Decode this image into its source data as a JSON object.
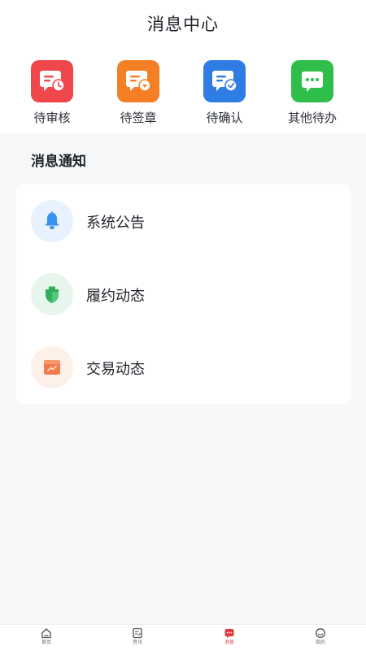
{
  "header": {
    "title": "消息中心"
  },
  "quick_actions": [
    {
      "label": "待审核",
      "icon": "pending-review-icon",
      "color": "#f0474b"
    },
    {
      "label": "待签章",
      "icon": "pending-seal-icon",
      "color": "#f47f24"
    },
    {
      "label": "待确认",
      "icon": "pending-confirm-icon",
      "color": "#2f7ce5"
    },
    {
      "label": "其他待办",
      "icon": "other-todo-icon",
      "color": "#2fbe4a"
    }
  ],
  "section": {
    "title": "消息通知"
  },
  "notifications": [
    {
      "label": "系统公告",
      "icon": "bell-icon",
      "color": "#3b8ff0",
      "bg": "#e8f2fe"
    },
    {
      "label": "履约动态",
      "icon": "shield-icon",
      "color": "#2fae5c",
      "bg": "#e6f6ec"
    },
    {
      "label": "交易动态",
      "icon": "trend-card-icon",
      "color": "#f27b4b",
      "bg": "#fdf0e8"
    }
  ],
  "tabbar": {
    "items": [
      {
        "label": "首页",
        "icon": "home-icon"
      },
      {
        "label": "资讯",
        "icon": "news-icon"
      },
      {
        "label": "消息",
        "icon": "message-icon",
        "active": true
      },
      {
        "label": "我的",
        "icon": "profile-icon"
      }
    ],
    "active_color": "#e0393e"
  }
}
